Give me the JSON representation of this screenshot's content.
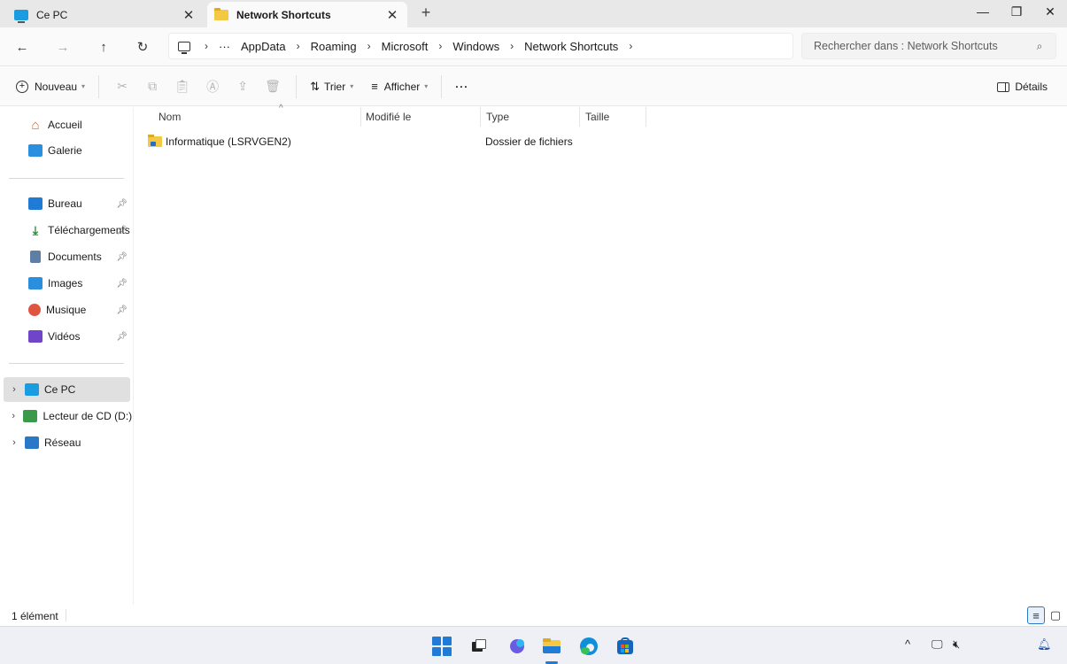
{
  "tabs": [
    {
      "label": "Ce PC",
      "icon": "monitor-icon",
      "active": false
    },
    {
      "label": "Network Shortcuts",
      "icon": "folder-icon",
      "active": true
    }
  ],
  "address": {
    "overflow": "···",
    "crumbs": [
      "AppData",
      "Roaming",
      "Microsoft",
      "Windows",
      "Network Shortcuts"
    ],
    "search_placeholder": "Rechercher dans : Network Shortcuts"
  },
  "commands": {
    "new_label": "Nouveau",
    "sort_label": "Trier",
    "view_label": "Afficher",
    "more_label": "···",
    "details_label": "Détails"
  },
  "nav": {
    "home": "Accueil",
    "gallery": "Galerie",
    "quick_access": [
      {
        "label": "Bureau",
        "icon": "desktop-icon"
      },
      {
        "label": "Téléchargements",
        "icon": "download-icon"
      },
      {
        "label": "Documents",
        "icon": "documents-icon"
      },
      {
        "label": "Images",
        "icon": "images-icon"
      },
      {
        "label": "Musique",
        "icon": "music-icon"
      },
      {
        "label": "Vidéos",
        "icon": "videos-icon"
      }
    ],
    "this_pc": "Ce PC",
    "cd_drive": "Lecteur de CD (D:) C",
    "network": "Réseau"
  },
  "columns": {
    "name": "Nom",
    "modified": "Modifié le",
    "type": "Type",
    "size": "Taille"
  },
  "files": [
    {
      "name": "Informatique (LSRVGEN2)",
      "modified": "",
      "type": "Dossier de fichiers",
      "size": ""
    }
  ],
  "status": {
    "count": "1 élément"
  },
  "colors": {
    "accent": "#1f7bd6",
    "folder": "#f4c842",
    "selected_bg": "#e0e0e0"
  }
}
